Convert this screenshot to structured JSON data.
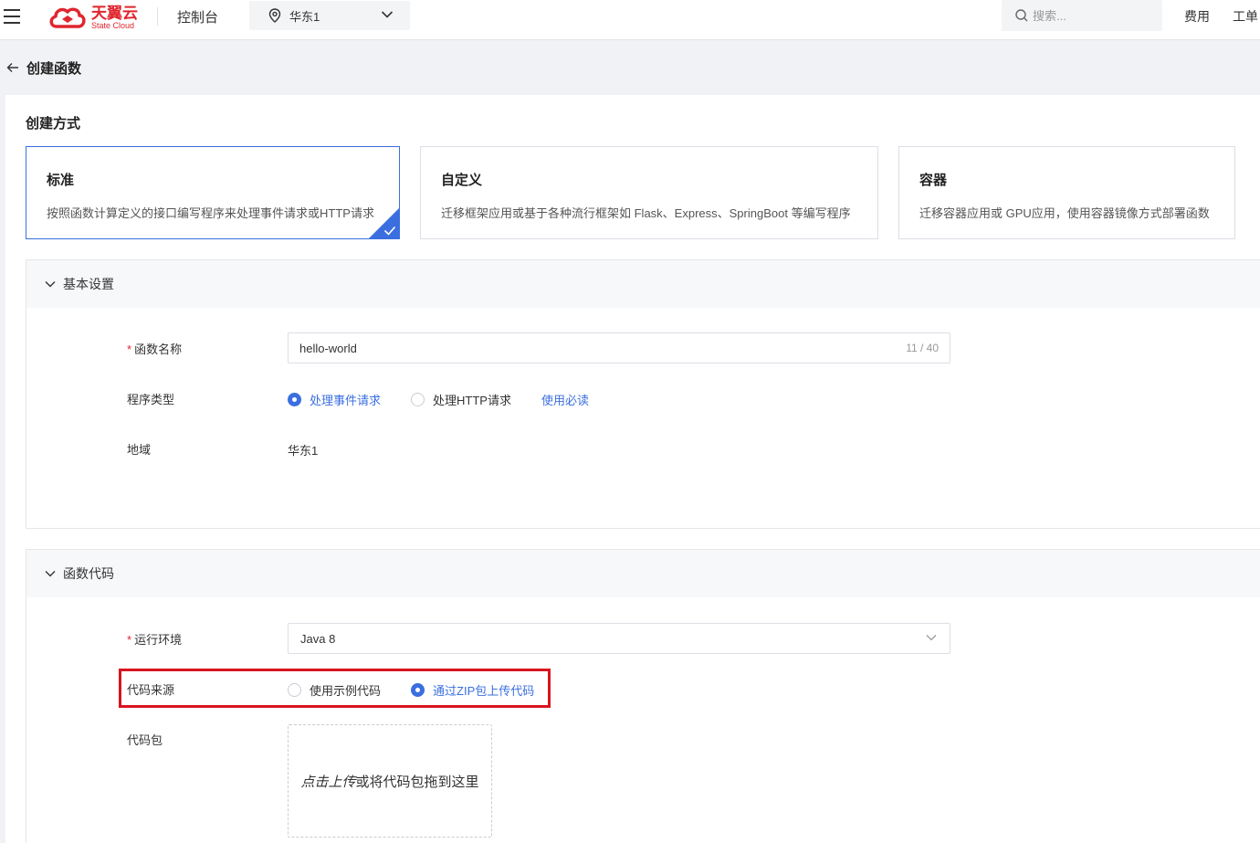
{
  "header": {
    "logo_cn": "天翼云",
    "logo_en": "State Cloud",
    "console_label": "控制台",
    "region_value": "华东1",
    "search_placeholder": "搜索...",
    "fee_link": "费用",
    "ticket_link": "工单"
  },
  "page": {
    "title": "创建函数"
  },
  "create_method": {
    "section_title": "创建方式",
    "cards": [
      {
        "title": "标准",
        "desc": "按照函数计算定义的接口编写程序来处理事件请求或HTTP请求",
        "selected": true
      },
      {
        "title": "自定义",
        "desc": "迁移框架应用或基于各种流行框架如 Flask、Express、SpringBoot 等编写程序",
        "selected": false
      },
      {
        "title": "容器",
        "desc": "迁移容器应用或 GPU应用，使用容器镜像方式部署函数",
        "selected": false
      }
    ]
  },
  "basic_settings": {
    "title": "基本设置",
    "function_name_label": "函数名称",
    "function_name_value": "hello-world",
    "function_name_count": "11 / 40",
    "program_type_label": "程序类型",
    "program_type_options": [
      "处理事件请求",
      "处理HTTP请求"
    ],
    "program_type_selected": "处理事件请求",
    "usage_link": "使用必读",
    "region_label": "地域",
    "region_value": "华东1"
  },
  "function_code": {
    "title": "函数代码",
    "runtime_label": "运行环境",
    "runtime_value": "Java 8",
    "code_source_label": "代码来源",
    "code_source_options": [
      "使用示例代码",
      "通过ZIP包上传代码"
    ],
    "code_source_selected": "通过ZIP包上传代码",
    "code_package_label": "代码包",
    "upload_click": "点击上传",
    "upload_rest": "或将代码包拖到这里"
  },
  "colors": {
    "accent": "#3b6fe0",
    "brand_red": "#e0262e",
    "highlight_red": "#d9141e"
  }
}
